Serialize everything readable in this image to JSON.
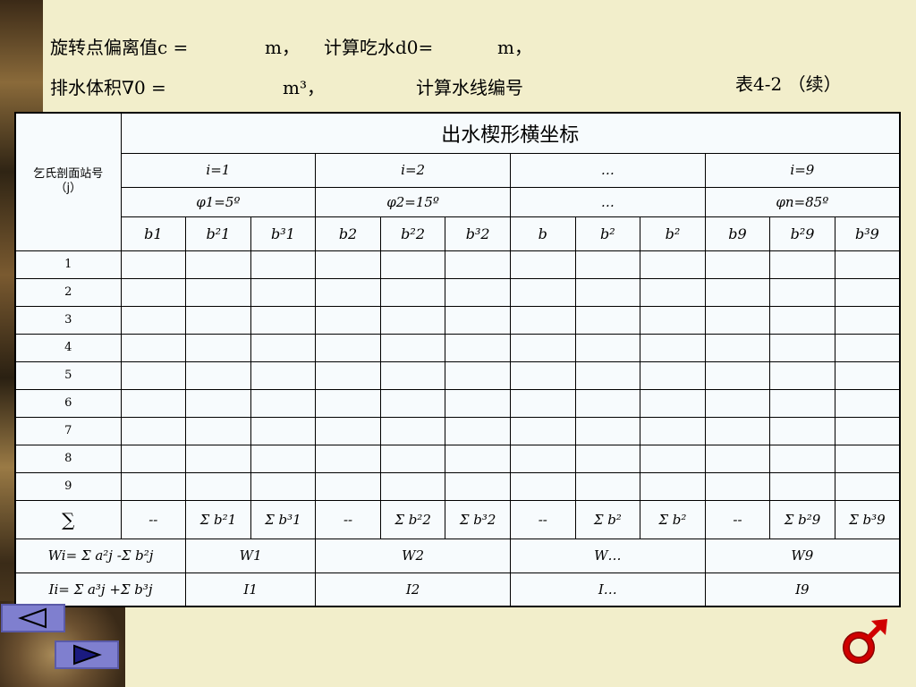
{
  "header": {
    "line1a": "旋转点偏离值c =",
    "line1b": "m，",
    "line1c": "计算吃水d0=",
    "line1d": "m，",
    "line2a": "排水体积∇0 =",
    "line2b": "m³，",
    "line2c": "计算水线编号",
    "table_no": "表4-2 （续）"
  },
  "table": {
    "title": "出水楔形横坐标",
    "row_header": {
      "label": "乞氏剖面站号",
      "sub": "（j）"
    },
    "groups": [
      "i=1",
      "i=2",
      "…",
      "i=9"
    ],
    "angles": [
      "φ1=5º",
      "φ2=15º",
      "…",
      "φn=85º"
    ],
    "subcols": [
      "b1",
      "b²1",
      "b³1",
      "b2",
      "b²2",
      "b³2",
      "b",
      "b²",
      "b²",
      "b9",
      "b²9",
      "b³9"
    ],
    "stations": [
      "1",
      "2",
      "3",
      "4",
      "5",
      "6",
      "7",
      "8",
      "9"
    ],
    "sum_label": "∑",
    "sum_cells": [
      "--",
      "Σ b²1",
      "Σ b³1",
      "--",
      "Σ b²2",
      "Σ b³2",
      "--",
      "Σ b²",
      "Σ b²",
      "--",
      "Σ b²9",
      "Σ b³9"
    ],
    "w_label": "Wi= Σ a²j -Σ b²j",
    "w_values": [
      "W1",
      "W2",
      "W…",
      "W9"
    ],
    "i_label": "Ii= Σ a³j +Σ b³j",
    "i_values": [
      "I1",
      "I2",
      "I…",
      "I9"
    ]
  },
  "nav": {
    "prev": "triangle-left-icon",
    "next": "triangle-right-icon",
    "logo": "mars-symbol-icon"
  }
}
